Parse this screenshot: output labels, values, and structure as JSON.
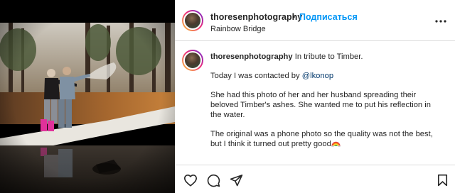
{
  "post": {
    "username": "thoresenphotography",
    "separator": "•",
    "follow_label": "Подписаться",
    "location": "Rainbow Bridge"
  },
  "caption": {
    "username": "thoresenphotography",
    "intro": "In tribute to Timber.",
    "line1_prefix": "Today I was contacted by ",
    "mention": "@lkonop",
    "paragraph2": "She had this photo of her and her husband spreading their beloved Timber's ashes. She wanted me to put his reflection in the water.",
    "paragraph3": "The original was a phone photo so the quality was not the best, but I think it turned out pretty good"
  },
  "icons": {
    "more": "more-options-icon",
    "like": "heart-icon",
    "comment": "comment-icon",
    "share": "paper-plane-icon",
    "save": "bookmark-icon",
    "emoji": "rainbow-emoji"
  },
  "colors": {
    "follow": "#0095f6",
    "mention": "#00376b",
    "text": "#262626",
    "divider": "#dbdbdb"
  }
}
